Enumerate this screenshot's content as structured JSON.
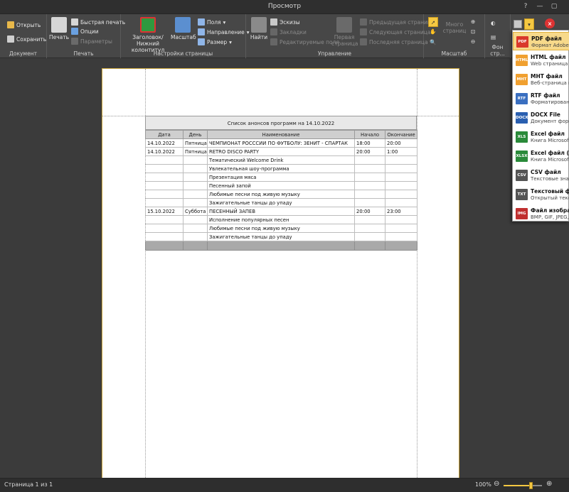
{
  "window": {
    "title": "Просмотр"
  },
  "ribbon": {
    "document": {
      "label": "Документ",
      "open": "Открыть",
      "save": "Сохранить"
    },
    "print": {
      "label": "Печать",
      "print": "Печать",
      "quick_print": "Быстрая печать",
      "options": "Опции",
      "params": "Параметры"
    },
    "page_setup": {
      "label": "Настройки страницы",
      "header_footer_1": "Заголовок/Нижний",
      "header_footer_2": "колонтитул",
      "scale": "Масштаб",
      "margins": "Поля",
      "orientation": "Направление",
      "size": "Размер"
    },
    "control": {
      "label": "Управление",
      "find": "Найти",
      "thumbnails": "Эскизы",
      "bookmarks": "Закладки",
      "editable_fields": "Редактируемые поля",
      "first_page_1": "Первая",
      "first_page_2": "страница",
      "prev_page": "Предыдущая страница",
      "next_page": "Следующая страница",
      "last_page": "Последняя страница"
    },
    "zoom": {
      "label": "Масштаб",
      "many_pages_1": "Много",
      "many_pages_2": "страниц"
    },
    "bg": {
      "label": "Фон стр..."
    }
  },
  "report": {
    "title": "Список анонсов программ на 14.10.2022",
    "columns": [
      "Дата",
      "День",
      "Наименование",
      "Начало",
      "Окончание"
    ],
    "rows": [
      [
        "14.10.2022",
        "Пятница",
        "ЧЕМПИОНАТ РОСССИИ ПО ФУТБОЛУ: ЗЕНИТ - СПАРТАК",
        "18:00",
        "20:00"
      ],
      [
        "14.10.2022",
        "Пятница",
        "RETRO DISCO PARTY",
        "20:00",
        "1:00"
      ],
      [
        "",
        "",
        "Тематический Welcome Drink",
        "",
        ""
      ],
      [
        "",
        "",
        "Увлекательная шоу-программа",
        "",
        ""
      ],
      [
        "",
        "",
        "Презентация мяса",
        "",
        ""
      ],
      [
        "",
        "",
        "Песенный запой",
        "",
        ""
      ],
      [
        "",
        "",
        "Любимые песни под живую музыку",
        "",
        ""
      ],
      [
        "",
        "",
        "Зажигательные танцы до упаду",
        "",
        ""
      ],
      [
        "15.10.2022",
        "Суббота",
        "ПЕСЕННЫЙ ЗАПЕВ",
        "20:00",
        "23:00"
      ],
      [
        "",
        "",
        "Исполнение популярных песен",
        "",
        ""
      ],
      [
        "",
        "",
        "Любимые песни под живую музыку",
        "",
        ""
      ],
      [
        "",
        "",
        "Зажигательные танцы до упаду",
        "",
        ""
      ]
    ]
  },
  "export_menu": [
    {
      "icon_text": "PDF",
      "color": "#d9382b",
      "title": "PDF файл",
      "desc": "Формат Adobe Port"
    },
    {
      "icon_text": "HTML",
      "color": "#f0a030",
      "title": "HTML файл",
      "desc": "Web страница"
    },
    {
      "icon_text": "MHT",
      "color": "#f0a030",
      "title": "MHT файл",
      "desc": "Веб-страница в од"
    },
    {
      "icon_text": "RTF",
      "color": "#3a6fc0",
      "title": "RTF файл",
      "desc": "Форматированный"
    },
    {
      "icon_text": "DOCX",
      "color": "#2a5fb0",
      "title": "DOCX File",
      "desc": "Документ формат"
    },
    {
      "icon_text": "XLS",
      "color": "#2a8a3a",
      "title": "Excel файл",
      "desc": "Книга Microsoft Ex"
    },
    {
      "icon_text": "XLSX",
      "color": "#2a8a3a",
      "title": "Excel файл (.XLS",
      "desc": "Книга Microsoft Ex"
    },
    {
      "icon_text": "CSV",
      "color": "#555555",
      "title": "CSV файл",
      "desc": "Текстовые значен"
    },
    {
      "icon_text": "TXT",
      "color": "#555555",
      "title": "Текстовый фай",
      "desc": "Открытый текст"
    },
    {
      "icon_text": "IMG",
      "color": "#c03030",
      "title": "Файл изображе",
      "desc": "BMP, GIF, JPEG, PN"
    }
  ],
  "status": {
    "page": "Страница 1 из 1",
    "zoom": "100%",
    "zoom_level_percent": 70
  }
}
